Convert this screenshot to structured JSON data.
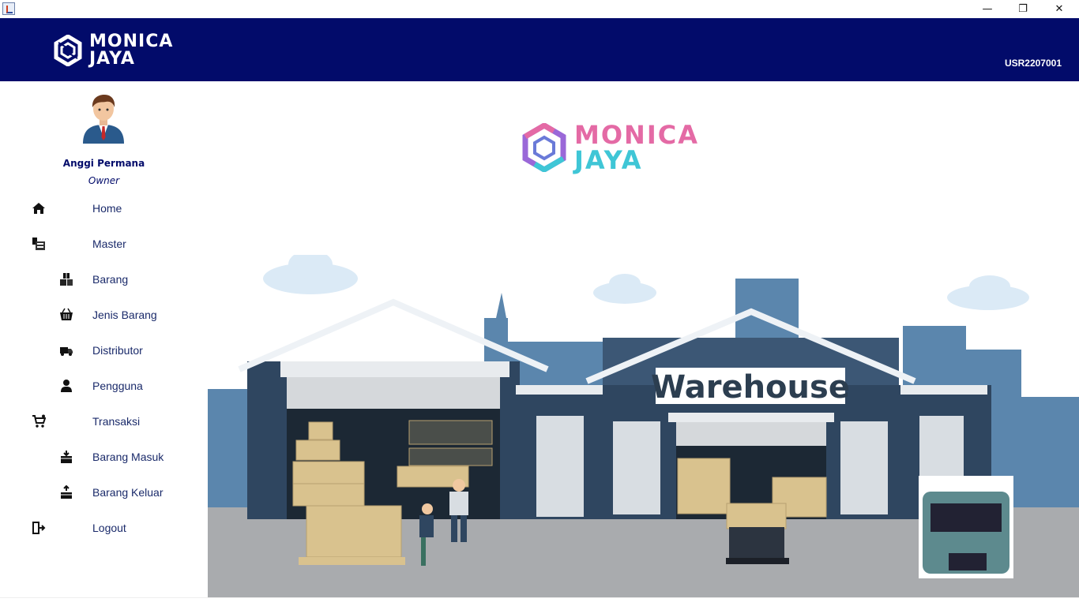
{
  "window": {
    "minimize_glyph": "—",
    "maximize_glyph": "❐",
    "close_glyph": "✕",
    "icon": "java-app-icon"
  },
  "header": {
    "brand_line1": "MONICA",
    "brand_line2": "JAYA",
    "user_id": "USR2207001",
    "background": "#020b6a"
  },
  "profile": {
    "name": "Anggi Permana",
    "role": "Owner"
  },
  "menu": [
    {
      "label": "Home",
      "icon": "home-icon"
    },
    {
      "label": "Master",
      "icon": "master-icon"
    },
    {
      "label": "Barang",
      "icon": "boxes-icon"
    },
    {
      "label": "Jenis Barang",
      "icon": "basket-icon"
    },
    {
      "label": "Distributor",
      "icon": "truck-icon"
    },
    {
      "label": "Pengguna",
      "icon": "user-icon"
    },
    {
      "label": "Transaksi",
      "icon": "cart-icon"
    },
    {
      "label": "Barang Masuk",
      "icon": "box-in-icon"
    },
    {
      "label": "Barang Keluar",
      "icon": "box-out-icon"
    },
    {
      "label": "Logout",
      "icon": "logout-icon"
    }
  ],
  "main": {
    "logo_line1": "MONICA",
    "logo_line2": "JAYA",
    "warehouse_sign": "Warehouse"
  },
  "colors": {
    "navy": "#020b6a",
    "menu_text": "#1a2a6a",
    "logo_pink": "#e46aa5",
    "logo_cyan": "#3fc6d6"
  }
}
